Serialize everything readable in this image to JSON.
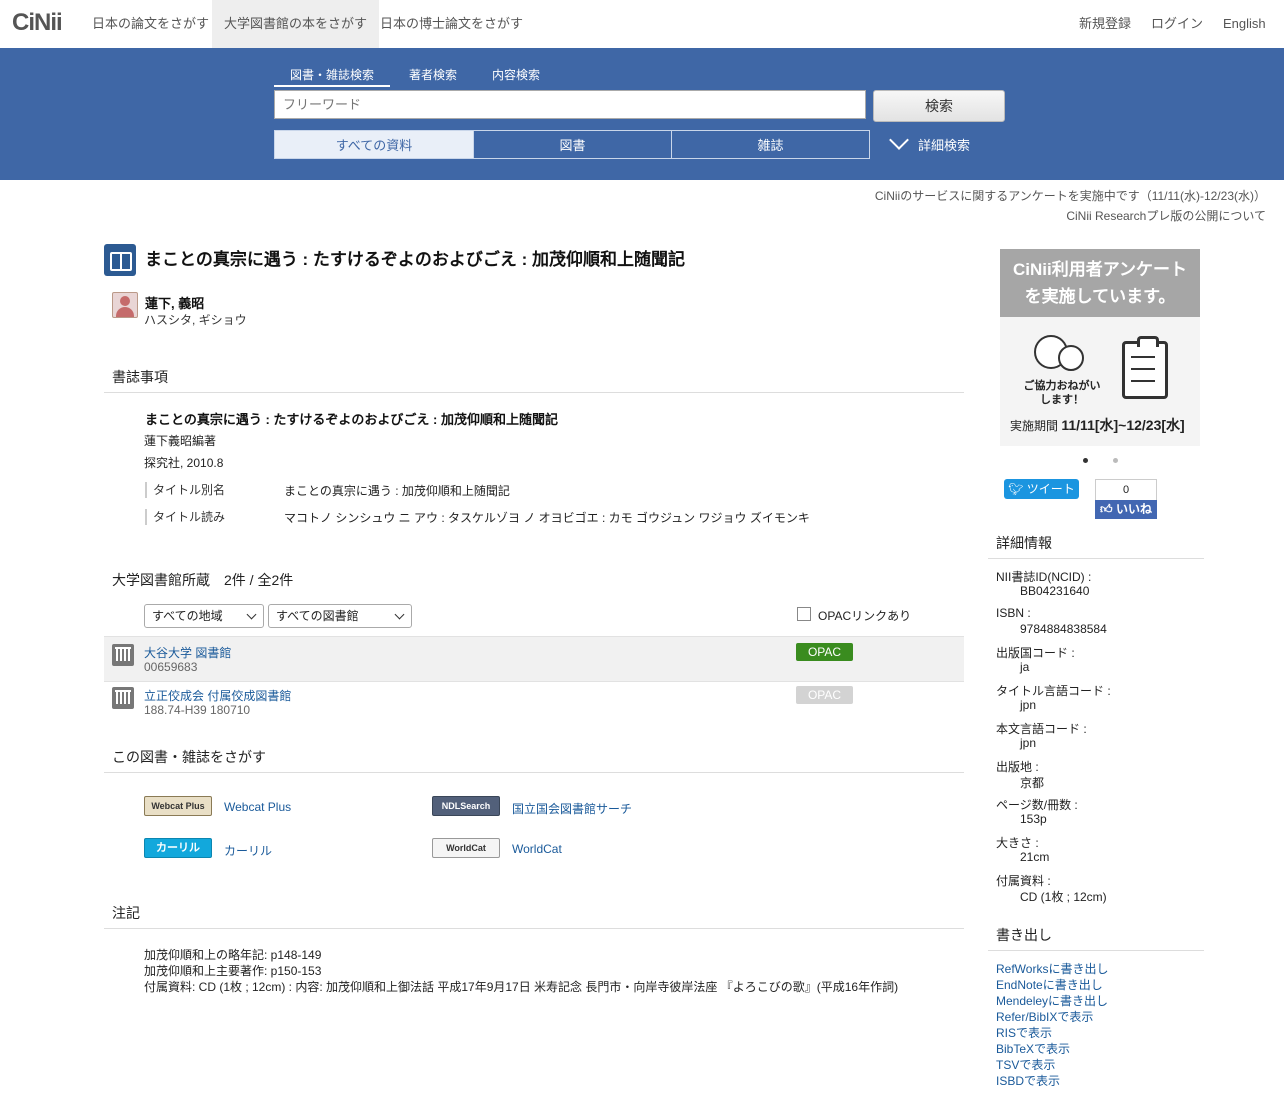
{
  "nav": {
    "logo": "CiNii",
    "tabs": [
      "日本の論文をさがす",
      "大学図書館の本をさがす",
      "日本の博士論文をさがす"
    ],
    "right": [
      "新規登録",
      "ログイン",
      "English"
    ]
  },
  "search": {
    "tabs": [
      "図書・雑誌検索",
      "著者検索",
      "内容検索"
    ],
    "placeholder": "フリーワード",
    "button": "検索",
    "types": [
      "すべての資料",
      "図書",
      "雑誌"
    ],
    "advanced": "詳細検索"
  },
  "notices": [
    "CiNiiのサービスに関するアンケートを実施中です（11/11(水)-12/23(水)）",
    "CiNii Researchプレ版の公開について"
  ],
  "book": {
    "title": "まことの真宗に遇う : たすけるぞよのおよびごえ : 加茂仰順和上随聞記",
    "author": "蓮下, 義昭",
    "author_kana": "ハスシタ, ギショウ"
  },
  "bib": {
    "heading": "書誌事項",
    "title": "まことの真宗に遇う : たすけるぞよのおよびごえ : 加茂仰順和上随聞記",
    "responsibility": "蓮下義昭編著",
    "publication": "探究社, 2010.8",
    "fields": [
      {
        "key": "タイトル別名",
        "value": "まことの真宗に遇う : 加茂仰順和上随聞記"
      },
      {
        "key": "タイトル読み",
        "value": "マコトノ シンシュウ ニ アウ : タスケルゾヨ ノ オヨビゴエ : カモ ゴウジュン ワジョウ ズイモンキ"
      }
    ]
  },
  "holdings": {
    "heading": "大学図書館所蔵　2件 / 全2件",
    "region_select": "すべての地域",
    "library_select": "すべての図書館",
    "opac_filter": "OPACリンクあり",
    "libraries": [
      {
        "name": "大谷大学 図書館",
        "code": "00659683",
        "opac": "OPAC"
      },
      {
        "name": "立正佼成会 付属佼成図書館",
        "code": "188.74-H39  180710",
        "opac": "OPAC"
      }
    ]
  },
  "find": {
    "heading": "この図書・雑誌をさがす",
    "links": [
      {
        "logo": "Webcat Plus",
        "label": "Webcat Plus"
      },
      {
        "logo": "NDLSearch",
        "label": "国立国会図書館サーチ"
      },
      {
        "logo": "カーリル",
        "label": "カーリル"
      },
      {
        "logo": "WorldCat",
        "label": "WorldCat"
      }
    ]
  },
  "notes": {
    "heading": "注記",
    "lines": [
      "加茂仰順和上の略年記: p148-149",
      "加茂仰順和上主要著作: p150-153",
      "付属資料: CD (1枚 ; 12cm) : 内容: 加茂仰順和上御法話 平成17年9月17日 米寿記念 長門市・向岸寺彼岸法座 『よろこびの歌』(平成16年作詞)"
    ]
  },
  "banner": {
    "title_line1": "CiNii利用者アンケート",
    "title_line2": "を実施しています。",
    "sub_line1": "ご協力おねがい",
    "sub_line2": "します！",
    "period_label": "実施期間",
    "period": "11/11[水]~12/23[水]"
  },
  "social": {
    "tweet": "ツイート",
    "like_count": "0",
    "like": "いいね"
  },
  "details": {
    "heading": "詳細情報",
    "items": [
      {
        "key": "NII書誌ID(NCID) :",
        "value": "BB04231640"
      },
      {
        "key": "ISBN :",
        "value": "9784884838584"
      },
      {
        "key": "出版国コード :",
        "value": "ja"
      },
      {
        "key": "タイトル言語コード :",
        "value": "jpn"
      },
      {
        "key": "本文言語コード :",
        "value": "jpn"
      },
      {
        "key": "出版地 :",
        "value": "京都"
      },
      {
        "key": "ページ数/冊数 :",
        "value": "153p"
      },
      {
        "key": "大きさ :",
        "value": "21cm"
      },
      {
        "key": "付属資料 :",
        "value": "CD (1枚 ; 12cm)"
      }
    ]
  },
  "export": {
    "heading": "書き出し",
    "links": [
      "RefWorksに書き出し",
      "EndNoteに書き出し",
      "Mendeleyに書き出し",
      "Refer/BibIXで表示",
      "RISで表示",
      "BibTeXで表示",
      "TSVで表示",
      "ISBDで表示"
    ]
  },
  "colors": {
    "header": "#3f67a6",
    "opac_on": "#3a8c1f",
    "link": "#1a5a9a"
  }
}
